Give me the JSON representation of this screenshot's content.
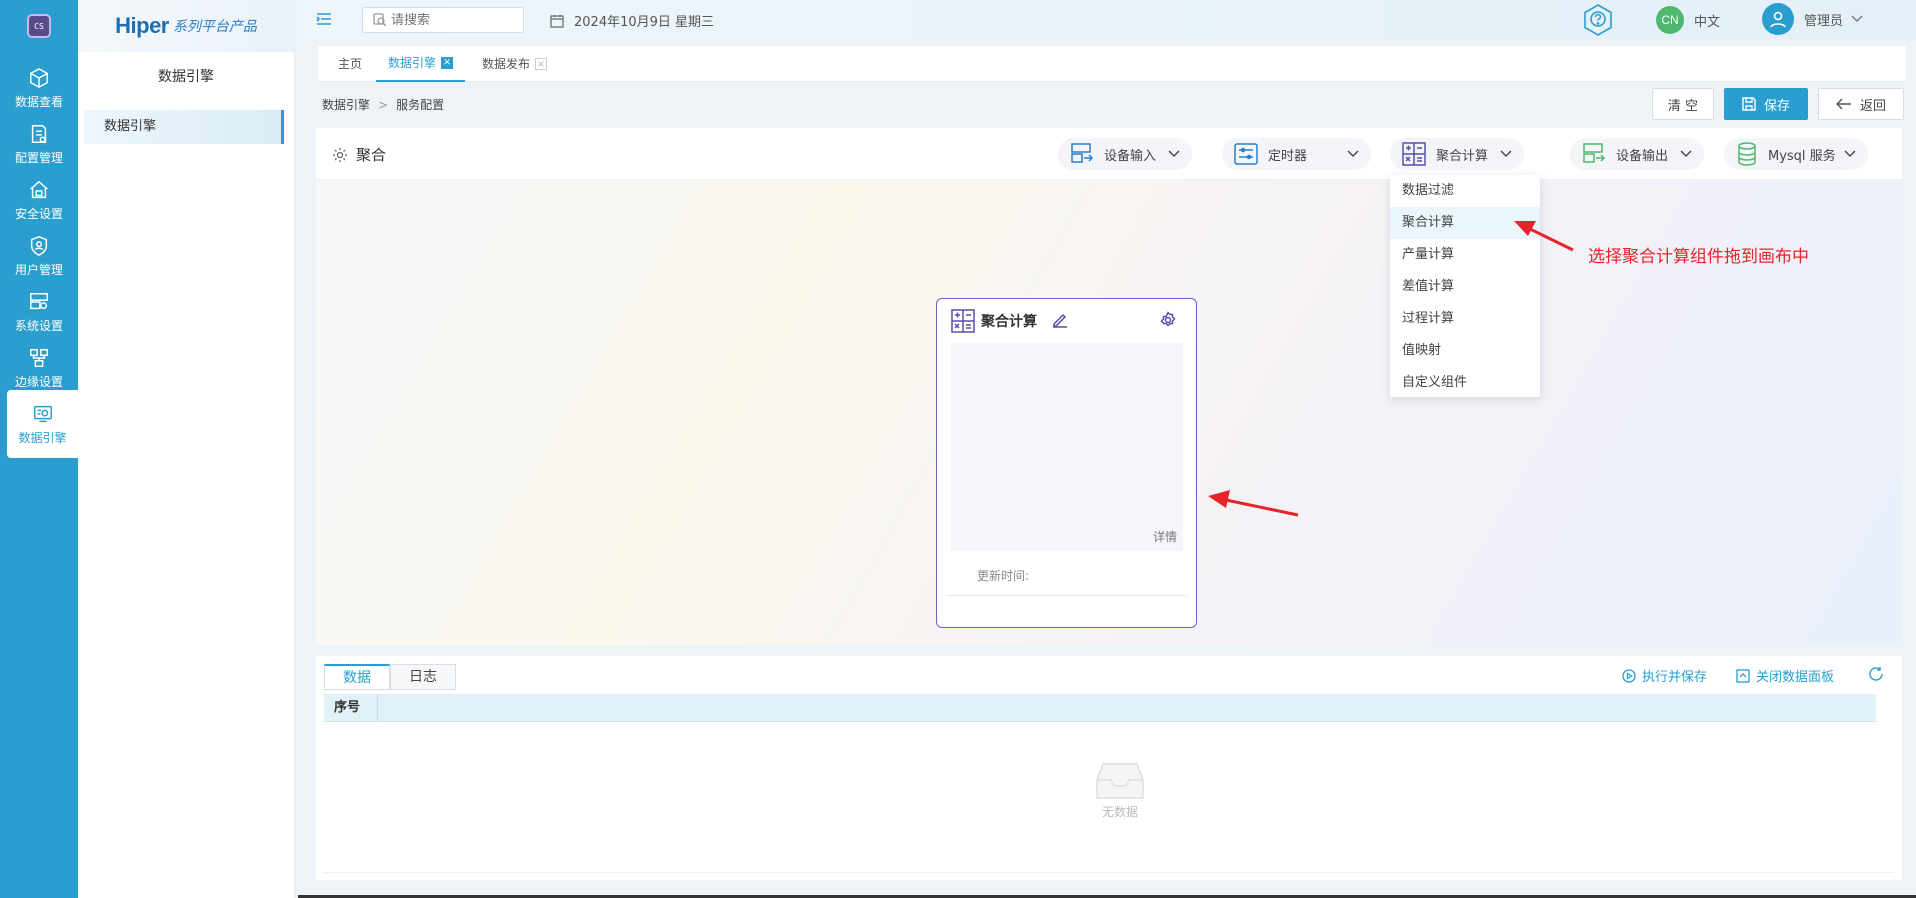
{
  "rail": {
    "logo_text": "CS",
    "items": [
      {
        "label": "数据查看",
        "icon": "cube-icon"
      },
      {
        "label": "配置管理",
        "icon": "book-settings-icon"
      },
      {
        "label": "安全设置",
        "icon": "home-lock-icon"
      },
      {
        "label": "用户管理",
        "icon": "shield-user-icon"
      },
      {
        "label": "系统设置",
        "icon": "server-gear-icon"
      },
      {
        "label": "边缘设置",
        "icon": "edge-nodes-icon"
      },
      {
        "label": "数据引擎",
        "icon": "engine-gear-icon"
      }
    ],
    "active_index": 6
  },
  "sidebar": {
    "brand_main": "Hiper",
    "brand_sub": "系列平台产品",
    "title": "数据引擎",
    "items": [
      {
        "label": "数据引擎"
      }
    ]
  },
  "topbar": {
    "search_placeholder": "请搜索",
    "date": "2024年10月9日 星期三",
    "lang_badge": "CN",
    "lang_label": "中文",
    "user_label": "管理员"
  },
  "tabs": [
    {
      "label": "主页",
      "active": false,
      "closable": false
    },
    {
      "label": "数据引擎",
      "active": true,
      "closable": true
    },
    {
      "label": "数据发布",
      "active": false,
      "closable": true
    }
  ],
  "breadcrumb": [
    "数据引擎",
    "服务配置"
  ],
  "actions": {
    "clear": "清 空",
    "save": "保存",
    "back": "返回"
  },
  "workspace": {
    "title": "聚合",
    "toolbar": [
      {
        "label": "设备输入",
        "icon": "device-input-icon"
      },
      {
        "label": "定时器",
        "icon": "timer-icon"
      },
      {
        "label": "聚合计算",
        "icon": "calculator-icon"
      },
      {
        "label": "设备输出",
        "icon": "device-output-icon"
      },
      {
        "label": "Mysql 服务",
        "icon": "database-icon"
      }
    ],
    "dropdown": {
      "items": [
        "数据过滤",
        "聚合计算",
        "产量计算",
        "差值计算",
        "过程计算",
        "值映射",
        "自定义组件"
      ],
      "highlighted_index": 1
    },
    "node": {
      "title": "聚合计算",
      "detail_link": "详情",
      "update_time_label": "更新时间:"
    },
    "annotation": "选择聚合计算组件拖到画布中"
  },
  "data_panel": {
    "tabs": [
      "数据",
      "日志"
    ],
    "active_tab": 0,
    "links": {
      "run_save": "执行并保存",
      "close_panel": "关闭数据面板"
    },
    "columns": [
      "序号"
    ],
    "empty_text": "无数据"
  },
  "colors": {
    "accent": "#2a9fcf",
    "node_border": "#6c62c9",
    "annotation": "#e8232a"
  }
}
